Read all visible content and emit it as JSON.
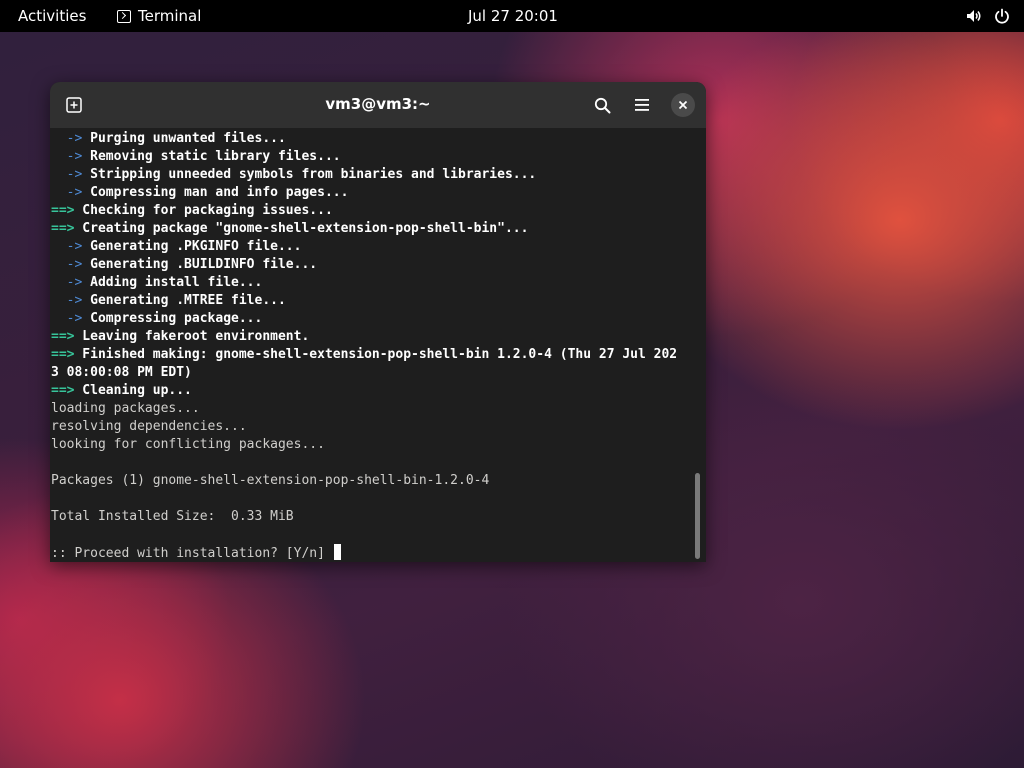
{
  "topbar": {
    "activities": "Activities",
    "app_name": "Terminal",
    "clock": "Jul 27  20:01",
    "icons": [
      "terminal-icon",
      "volume-icon",
      "power-icon"
    ]
  },
  "window": {
    "title": "vm3@vm3:~",
    "icons": [
      "new-tab-icon",
      "search-icon",
      "hamburger-menu-icon",
      "close-icon"
    ]
  },
  "colors": {
    "sub_arrow": "#4f8bd6",
    "main_arrow": "#37c59a",
    "terminal_bg": "#1e1e1e",
    "headerbar_bg": "#303030"
  },
  "terminal": {
    "lines": [
      {
        "prefix": "  ->",
        "kind": "sub",
        "text": " Purging unwanted files..."
      },
      {
        "prefix": "  ->",
        "kind": "sub",
        "text": " Removing static library files..."
      },
      {
        "prefix": "  ->",
        "kind": "sub",
        "text": " Stripping unneeded symbols from binaries and libraries..."
      },
      {
        "prefix": "  ->",
        "kind": "sub",
        "text": " Compressing man and info pages..."
      },
      {
        "prefix": "==>",
        "kind": "main",
        "text": " Checking for packaging issues..."
      },
      {
        "prefix": "==>",
        "kind": "main",
        "text": " Creating package \"gnome-shell-extension-pop-shell-bin\"..."
      },
      {
        "prefix": "  ->",
        "kind": "sub",
        "text": " Generating .PKGINFO file..."
      },
      {
        "prefix": "  ->",
        "kind": "sub",
        "text": " Generating .BUILDINFO file..."
      },
      {
        "prefix": "  ->",
        "kind": "sub",
        "text": " Adding install file..."
      },
      {
        "prefix": "  ->",
        "kind": "sub",
        "text": " Generating .MTREE file..."
      },
      {
        "prefix": "  ->",
        "kind": "sub",
        "text": " Compressing package..."
      },
      {
        "prefix": "==>",
        "kind": "main",
        "text": " Leaving fakeroot environment."
      },
      {
        "prefix": "==>",
        "kind": "main",
        "text": " Finished making: gnome-shell-extension-pop-shell-bin 1.2.0-4 (Thu 27 Jul 202"
      },
      {
        "prefix": "",
        "kind": "main-cont",
        "text": "3 08:00:08 PM EDT)"
      },
      {
        "prefix": "==>",
        "kind": "main",
        "text": " Cleaning up..."
      },
      {
        "prefix": "",
        "kind": "plain",
        "text": "loading packages..."
      },
      {
        "prefix": "",
        "kind": "plain",
        "text": "resolving dependencies..."
      },
      {
        "prefix": "",
        "kind": "plain",
        "text": "looking for conflicting packages..."
      },
      {
        "prefix": "",
        "kind": "plain",
        "text": ""
      },
      {
        "prefix": "",
        "kind": "plain",
        "text": "Packages (1) gnome-shell-extension-pop-shell-bin-1.2.0-4"
      },
      {
        "prefix": "",
        "kind": "plain",
        "text": ""
      },
      {
        "prefix": "",
        "kind": "plain",
        "text": "Total Installed Size:  0.33 MiB"
      },
      {
        "prefix": "",
        "kind": "plain",
        "text": ""
      }
    ],
    "prompt": ":: Proceed with installation? [Y/n] "
  }
}
